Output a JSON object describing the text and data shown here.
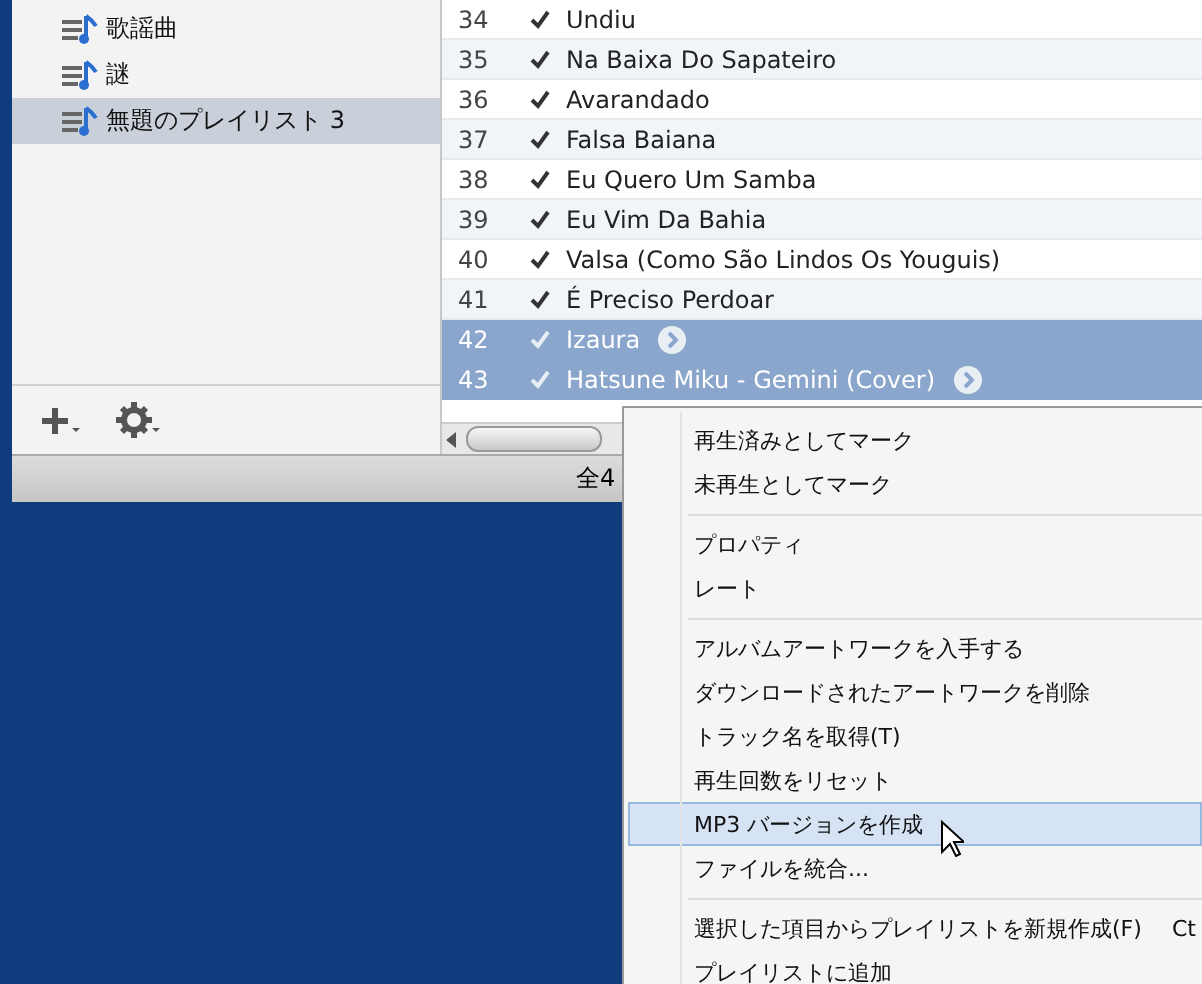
{
  "sidebar": {
    "playlists": [
      {
        "name": "歌謡曲",
        "selected": false
      },
      {
        "name": "謎",
        "selected": false
      },
      {
        "name": "無題のプレイリスト 3",
        "selected": true
      }
    ]
  },
  "tracks": [
    {
      "number": "34",
      "title": "Undiu",
      "checked": true,
      "selected": false
    },
    {
      "number": "35",
      "title": "Na Baixa Do Sapateiro",
      "checked": true,
      "selected": false
    },
    {
      "number": "36",
      "title": "Avarandado",
      "checked": true,
      "selected": false
    },
    {
      "number": "37",
      "title": "Falsa Baiana",
      "checked": true,
      "selected": false
    },
    {
      "number": "38",
      "title": "Eu Quero Um Samba",
      "checked": true,
      "selected": false
    },
    {
      "number": "39",
      "title": "Eu Vim Da Bahia",
      "checked": true,
      "selected": false
    },
    {
      "number": "40",
      "title": "Valsa (Como São Lindos Os Youguis)",
      "checked": true,
      "selected": false
    },
    {
      "number": "41",
      "title": "É Preciso Perdoar",
      "checked": true,
      "selected": false
    },
    {
      "number": "42",
      "title": "Izaura",
      "checked": true,
      "selected": true
    },
    {
      "number": "43",
      "title": "Hatsune Miku - Gemini  (Cover)",
      "checked": true,
      "selected": true
    }
  ],
  "status_bar": "全4",
  "context_menu": {
    "groups": [
      [
        {
          "label": "再生済みとしてマーク",
          "selected": false
        },
        {
          "label": "未再生としてマーク",
          "selected": false
        }
      ],
      [
        {
          "label": "プロパティ",
          "selected": false
        },
        {
          "label": "レート",
          "selected": false
        }
      ],
      [
        {
          "label": "アルバムアートワークを入手する",
          "selected": false
        },
        {
          "label": "ダウンロードされたアートワークを削除",
          "selected": false
        },
        {
          "label": "トラック名を取得(T)",
          "selected": false
        },
        {
          "label": "再生回数をリセット",
          "selected": false
        },
        {
          "label": "MP3 バージョンを作成",
          "selected": true
        },
        {
          "label": "ファイルを統合...",
          "selected": false
        }
      ],
      [
        {
          "label": "選択した項目からプレイリストを新規作成(F)",
          "selected": false,
          "shortcut": "Ct"
        },
        {
          "label": "プレイリストに追加",
          "selected": false
        }
      ]
    ]
  }
}
